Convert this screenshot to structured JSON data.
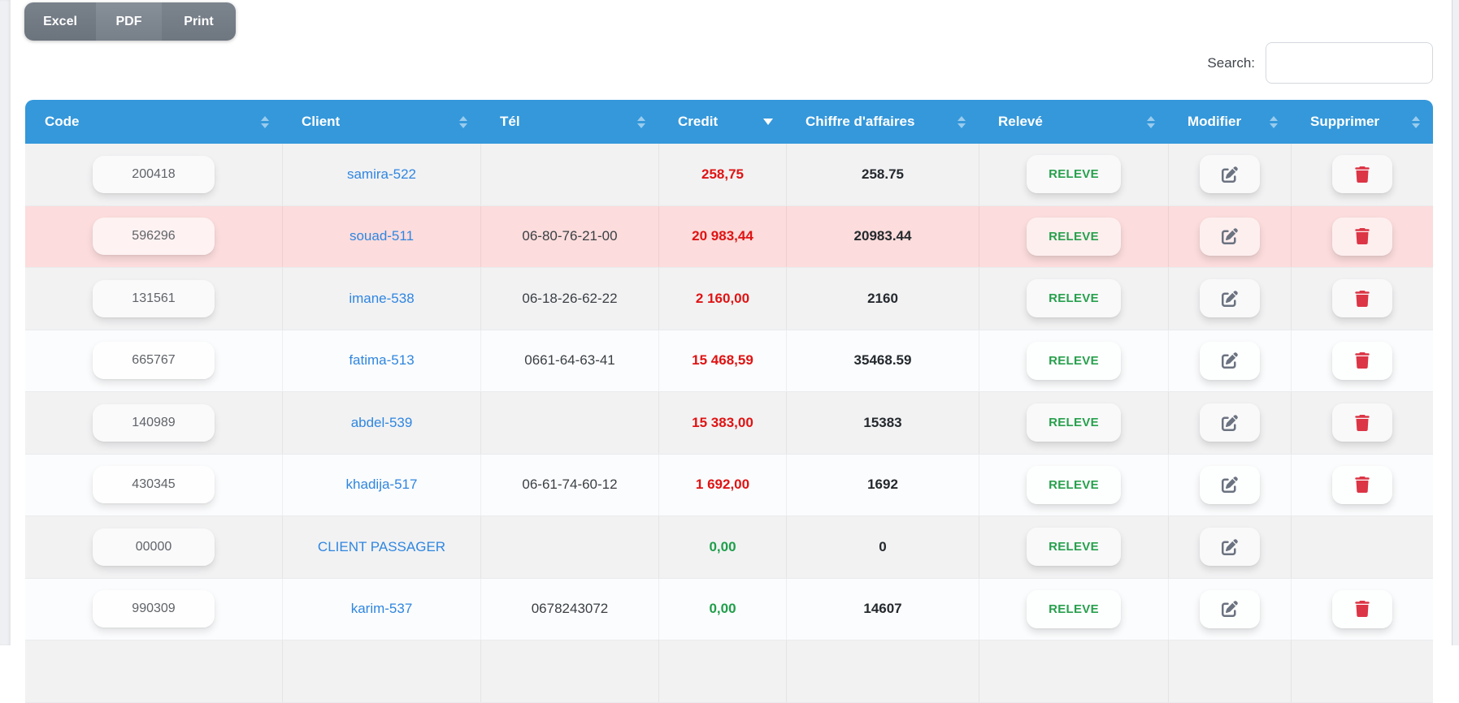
{
  "toolbar": {
    "buttons": [
      {
        "label": "Excel"
      },
      {
        "label": "PDF"
      },
      {
        "label": "Print"
      }
    ]
  },
  "search": {
    "label": "Search:",
    "value": ""
  },
  "colors": {
    "header_bg": "#3498db",
    "highlight_row": "#fcdcdc",
    "credit_debt": "#e01313",
    "credit_zero": "#1f9e4a",
    "releve_text": "#28a04d",
    "delete_icon": "#dc3545",
    "link": "#2f86e0"
  },
  "table": {
    "columns": [
      {
        "label": "Code",
        "sort": "both"
      },
      {
        "label": "Client",
        "sort": "both"
      },
      {
        "label": "Tél",
        "sort": "both"
      },
      {
        "label": "Credit",
        "sort": "desc"
      },
      {
        "label": "Chiffre d'affaires",
        "sort": "both"
      },
      {
        "label": "Relevé",
        "sort": "both"
      },
      {
        "label": "Modifier",
        "sort": "both"
      },
      {
        "label": "Supprimer",
        "sort": "both"
      }
    ],
    "releve_label": "RELEVE",
    "icons": {
      "edit": "edit-icon",
      "delete": "trash-icon",
      "sort_inactive": "sort-arrows-icon",
      "sort_desc": "sort-desc-icon"
    },
    "rows": [
      {
        "code": "200418",
        "client": "samira-522",
        "tel": "",
        "credit": "258,75",
        "credit_status": "debt",
        "chiffre_affaires": "258.75",
        "highlight": false,
        "can_delete": true
      },
      {
        "code": "596296",
        "client": "souad-511",
        "tel": "06-80-76-21-00",
        "credit": "20 983,44",
        "credit_status": "debt",
        "chiffre_affaires": "20983.44",
        "highlight": true,
        "can_delete": true
      },
      {
        "code": "131561",
        "client": "imane-538",
        "tel": "06-18-26-62-22",
        "credit": "2 160,00",
        "credit_status": "debt",
        "chiffre_affaires": "2160",
        "highlight": false,
        "can_delete": true
      },
      {
        "code": "665767",
        "client": "fatima-513",
        "tel": "0661-64-63-41",
        "credit": "15 468,59",
        "credit_status": "debt",
        "chiffre_affaires": "35468.59",
        "highlight": false,
        "can_delete": true
      },
      {
        "code": "140989",
        "client": "abdel-539",
        "tel": "",
        "credit": "15 383,00",
        "credit_status": "debt",
        "chiffre_affaires": "15383",
        "highlight": false,
        "can_delete": true
      },
      {
        "code": "430345",
        "client": "khadija-517",
        "tel": "06-61-74-60-12",
        "credit": "1 692,00",
        "credit_status": "debt",
        "chiffre_affaires": "1692",
        "highlight": false,
        "can_delete": true
      },
      {
        "code": "00000",
        "client": "CLIENT PASSAGER",
        "tel": "",
        "credit": "0,00",
        "credit_status": "zero",
        "chiffre_affaires": "0",
        "highlight": false,
        "can_delete": false
      },
      {
        "code": "990309",
        "client": "karim-537",
        "tel": "0678243072",
        "credit": "0,00",
        "credit_status": "zero",
        "chiffre_affaires": "14607",
        "highlight": false,
        "can_delete": true
      }
    ]
  }
}
